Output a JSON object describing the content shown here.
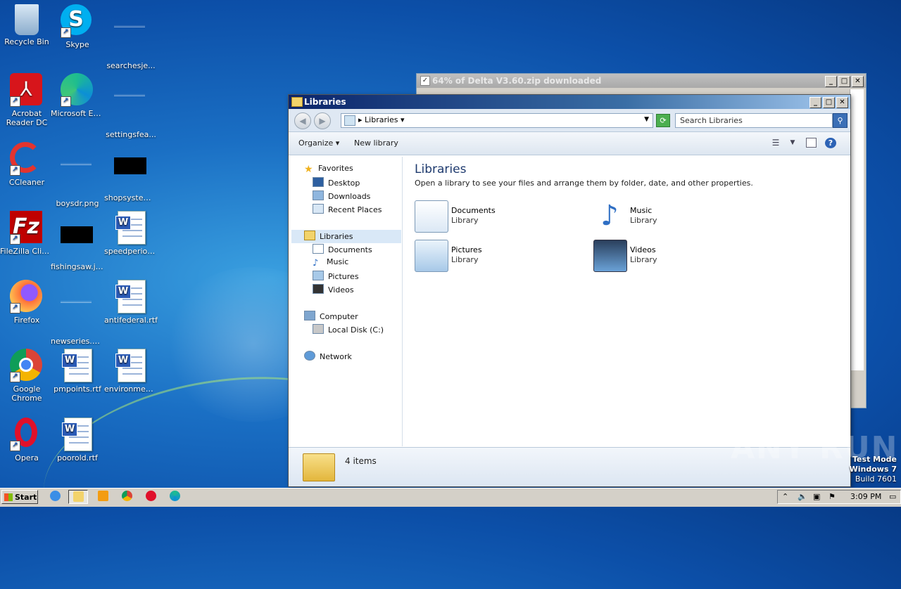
{
  "desktop": {
    "icons": [
      {
        "label": "Recycle Bin"
      },
      {
        "label": "Skype"
      },
      {
        "label": "searchesje..."
      },
      {
        "label": "Acrobat Reader DC"
      },
      {
        "label": "Microsoft Edge"
      },
      {
        "label": "settingsfea..."
      },
      {
        "label": "CCleaner"
      },
      {
        "label": "boysdr.png"
      },
      {
        "label": "shopsystem..."
      },
      {
        "label": "FileZilla Client"
      },
      {
        "label": "fishingsaw.jpg"
      },
      {
        "label": "speedperiod..."
      },
      {
        "label": "Firefox"
      },
      {
        "label": "newseries.png"
      },
      {
        "label": "antifederal.rtf"
      },
      {
        "label": "Google Chrome"
      },
      {
        "label": "pmpoints.rtf"
      },
      {
        "label": "environmen..."
      },
      {
        "label": "Opera"
      },
      {
        "label": "poorold.rtf"
      }
    ]
  },
  "download_window": {
    "title": "64% of Delta V3.60.zip downloaded",
    "progress_percent": 64
  },
  "explorer": {
    "title": "Libraries",
    "address": "Libraries",
    "search_placeholder": "Search Libraries",
    "toolbar": {
      "organize": "Organize",
      "new_library": "New library"
    },
    "nav": {
      "favorites": "Favorites",
      "desktop": "Desktop",
      "downloads": "Downloads",
      "recent": "Recent Places",
      "libraries": "Libraries",
      "documents": "Documents",
      "music": "Music",
      "pictures": "Pictures",
      "videos": "Videos",
      "computer": "Computer",
      "local_disk": "Local Disk (C:)",
      "network": "Network"
    },
    "heading": "Libraries",
    "subtitle": "Open a library to see your files and arrange them by folder, date, and other properties.",
    "libraries": [
      {
        "name": "Documents",
        "type": "Library"
      },
      {
        "name": "Music",
        "type": "Library"
      },
      {
        "name": "Pictures",
        "type": "Library"
      },
      {
        "name": "Videos",
        "type": "Library"
      }
    ],
    "status": "4 items"
  },
  "watermark": {
    "brand": "ANY RUN",
    "test_mode": "Test Mode",
    "os": "Windows 7",
    "build": "Build 7601"
  },
  "taskbar": {
    "start": "Start",
    "clock": "3:09 PM"
  }
}
